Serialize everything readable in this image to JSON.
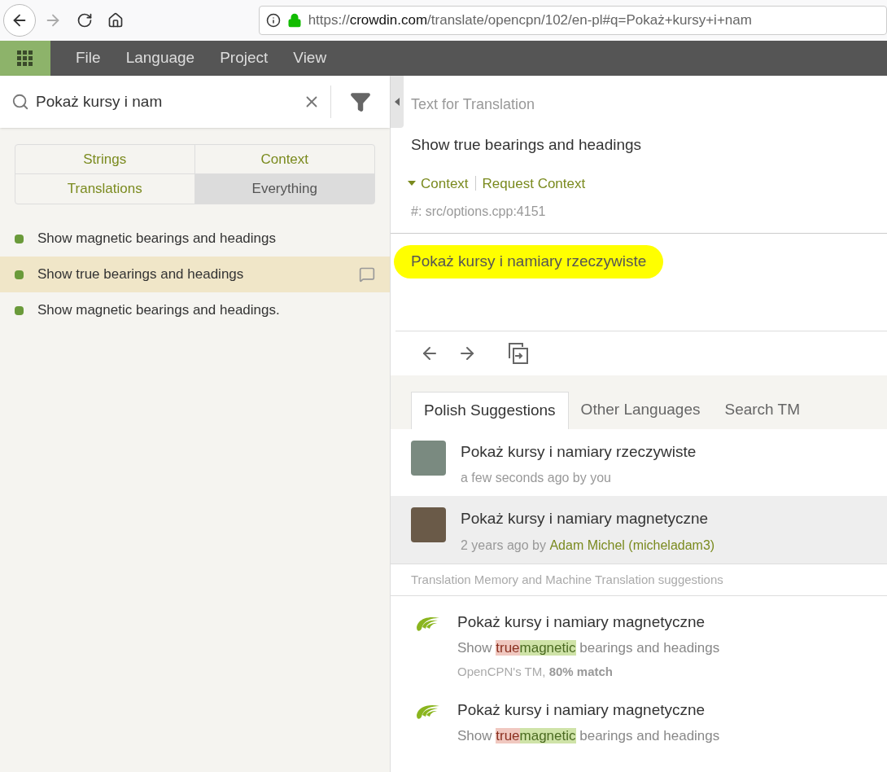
{
  "browser": {
    "url": {
      "scheme": "https://",
      "host": "crowdin.com",
      "path": "/translate/opencpn/102/en-pl#q=Pokaż+kursy+i+nam"
    }
  },
  "menu": [
    "File",
    "Language",
    "Project",
    "View"
  ],
  "search": {
    "value": "Pokaż kursy i nam"
  },
  "filters": [
    {
      "label": "Strings",
      "selected": false
    },
    {
      "label": "Context",
      "selected": false
    },
    {
      "label": "Translations",
      "selected": false
    },
    {
      "label": "Everything",
      "selected": true
    }
  ],
  "strings": [
    {
      "text": "Show magnetic bearings and headings",
      "selected": false,
      "comment": false,
      "color": "#6a9a3a"
    },
    {
      "text": "Show true bearings and headings",
      "selected": true,
      "comment": true,
      "color": "#6a9a3a"
    },
    {
      "text": "Show magnetic bearings and headings.",
      "selected": false,
      "comment": false,
      "color": "#6a9a3a"
    }
  ],
  "source": {
    "heading": "Text for Translation",
    "text": "Show true bearings and headings",
    "context_toggle": "Context",
    "request_context": "Request Context",
    "context": "#: src/options.cpp:4151"
  },
  "translation": {
    "value": "Pokaż kursy i namiary rzeczywiste",
    "highlighted": true
  },
  "suggestion_tabs": [
    {
      "label": "Polish Suggestions",
      "selected": true
    },
    {
      "label": "Other Languages",
      "selected": false
    },
    {
      "label": "Search TM",
      "selected": false
    }
  ],
  "suggestions": [
    {
      "text": "Pokaż kursy i namiary rzeczywiste",
      "meta": "a few seconds ago by you",
      "selected": false
    },
    {
      "text": "Pokaż kursy i namiary magnetyczne",
      "meta": "2 years ago by ",
      "author": "Adam Michel (micheladam3)",
      "selected": true
    }
  ],
  "tm_heading": "Translation Memory and Machine Translation suggestions",
  "tm": [
    {
      "text": "Pokaż kursy i namiary magnetyczne",
      "diff": [
        {
          "kind": "same",
          "text": "Show "
        },
        {
          "kind": "removed",
          "text": "true"
        },
        {
          "kind": "added",
          "text": "magnetic"
        },
        {
          "kind": "same",
          "text": " bearings and headings"
        }
      ],
      "source": "OpenCPN's TM, **80% match**"
    },
    {
      "text": "Pokaż kursy i namiary magnetyczne",
      "diff": [
        {
          "kind": "same",
          "text": "Show "
        },
        {
          "kind": "removed",
          "text": "true"
        },
        {
          "kind": "added",
          "text": "magnetic"
        },
        {
          "kind": "same",
          "text": " bearings and headings"
        }
      ]
    }
  ]
}
